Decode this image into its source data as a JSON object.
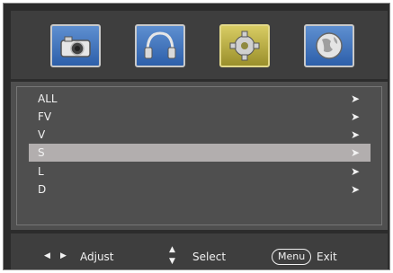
{
  "tabs": [
    {
      "icon": "picture-icon",
      "selected": false
    },
    {
      "icon": "sound-icon",
      "selected": false
    },
    {
      "icon": "setup-gear-icon",
      "selected": true
    },
    {
      "icon": "globe-icon",
      "selected": false
    }
  ],
  "menu": {
    "items": [
      {
        "label": "ALL",
        "arrow": "➤"
      },
      {
        "label": "FV",
        "arrow": "➤"
      },
      {
        "label": "V",
        "arrow": "➤"
      },
      {
        "label": "S",
        "arrow": "➤"
      },
      {
        "label": "L",
        "arrow": "➤"
      },
      {
        "label": "D",
        "arrow": "➤"
      }
    ],
    "selected_index": 3
  },
  "footer": {
    "left_arrow": "◀",
    "right_arrow": "▶",
    "adjust_label": "Adjust",
    "up_arrow": "▲",
    "down_arrow": "▼",
    "select_label": "Select",
    "menu_key": "Menu",
    "exit_label": "Exit"
  },
  "colors": {
    "selected_tab": "#d8cc63",
    "tab": "#3f74c0",
    "selected_row": "#b2aeae"
  }
}
